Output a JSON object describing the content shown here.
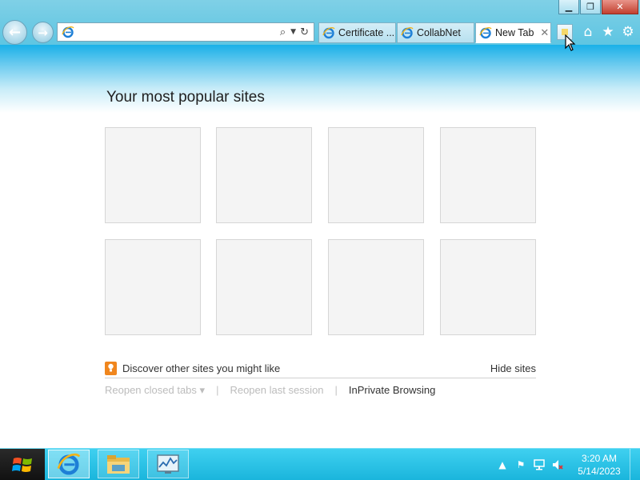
{
  "window": {
    "controls": {
      "minimize": "▁",
      "restore": "❐",
      "close": "✕"
    }
  },
  "navigation": {
    "back_icon": "back-arrow-icon",
    "forward_icon": "forward-arrow-icon"
  },
  "address_bar": {
    "value": "",
    "placeholder": "",
    "search_icon": "search-icon",
    "dropdown_icon": "chevron-down-icon",
    "refresh_icon": "refresh-icon"
  },
  "tabs": [
    {
      "label": "Certificate ...",
      "active": false
    },
    {
      "label": "CollabNet",
      "active": false
    },
    {
      "label": "New Tab",
      "active": true,
      "close": "✕"
    }
  ],
  "command_icons": [
    "home-icon",
    "favorites-star-icon",
    "tools-gear-icon"
  ],
  "new_tab_page": {
    "title": "Your most popular sites",
    "tile_count": 8,
    "discover_text": "Discover other sites you might like",
    "hide_sites": "Hide sites",
    "footer_links": [
      {
        "label": "Reopen closed tabs ▾",
        "enabled": false
      },
      {
        "label": "Reopen last session",
        "enabled": false
      },
      {
        "label": "InPrivate Browsing",
        "enabled": true
      }
    ],
    "separator": "|"
  },
  "taskbar": {
    "apps": [
      "internet-explorer",
      "file-explorer",
      "resource-monitor"
    ],
    "tray_icons": [
      "show-hidden-icons",
      "action-center-flag-icon",
      "network-icon",
      "volume-muted-icon"
    ],
    "time": "3:20 AM",
    "date": "5/14/2023"
  },
  "colors": {
    "accent": "#1ab5dc",
    "chrome": "#5ec5e2",
    "tile_bg": "#f4f4f4",
    "bulb": "#f0861d"
  }
}
